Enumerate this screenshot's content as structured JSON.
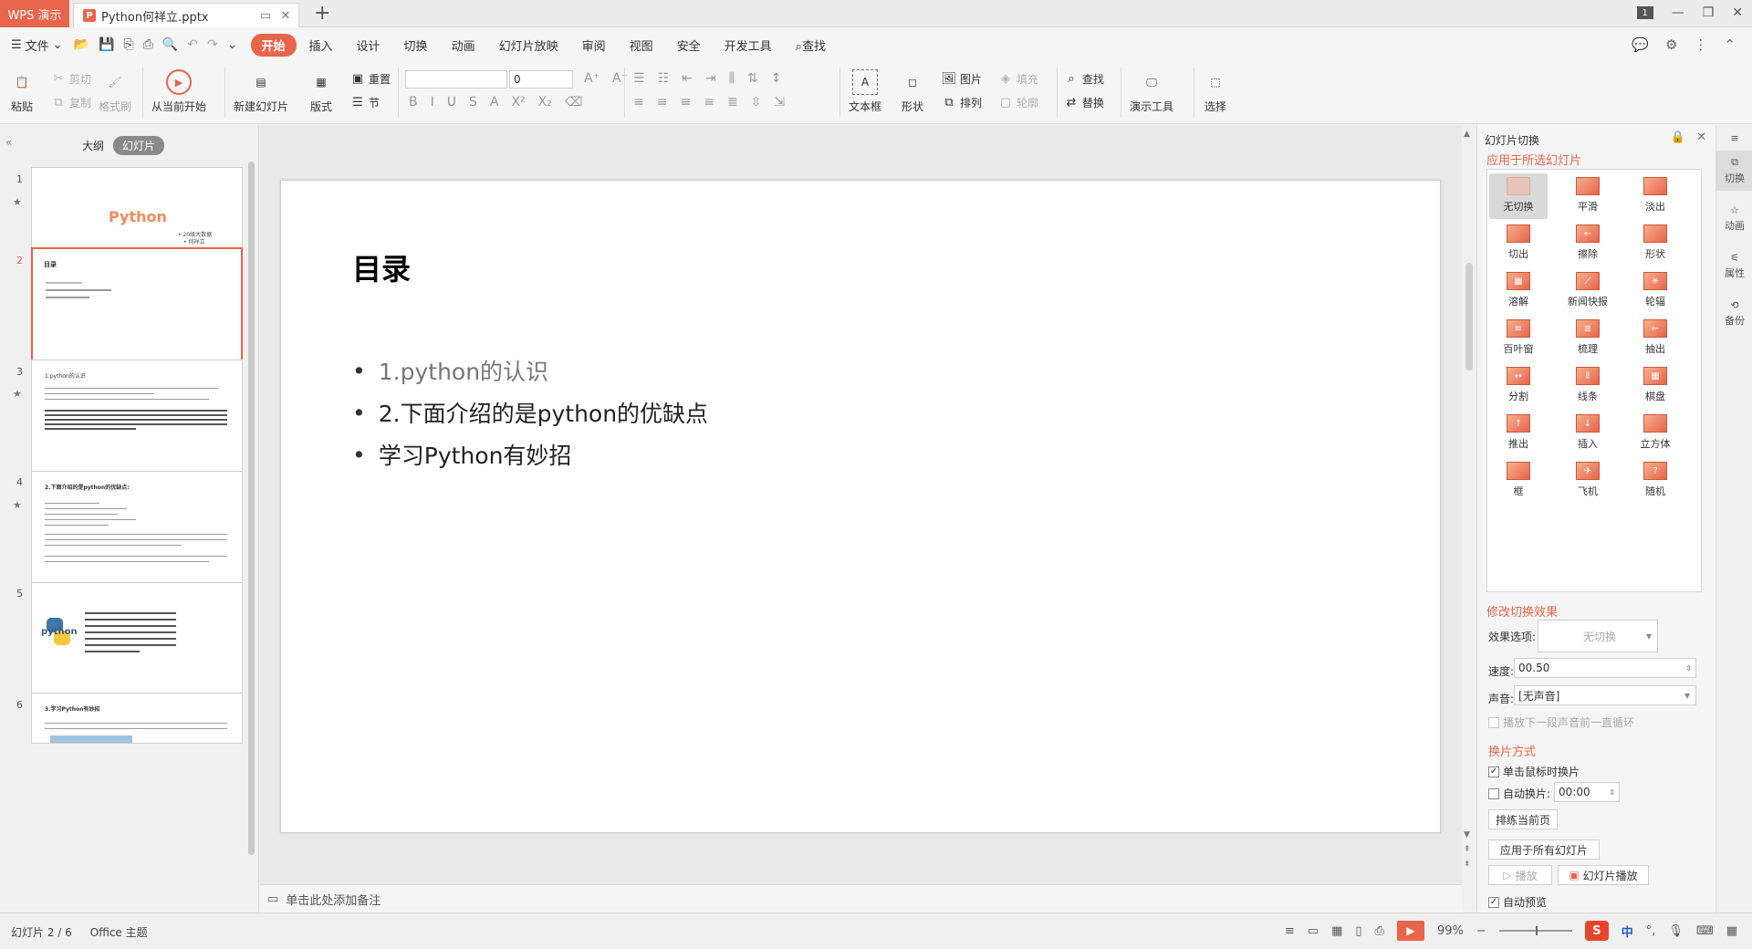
{
  "titlebar": {
    "app_tab": "WPS 演示",
    "doc_tab": "Python何祥立.pptx",
    "new_tab": "+",
    "badge": "1"
  },
  "menubar": {
    "file_label": "文件",
    "items": [
      "开始",
      "插入",
      "设计",
      "切换",
      "动画",
      "幻灯片放映",
      "审阅",
      "视图",
      "安全",
      "开发工具"
    ],
    "active_item": "开始",
    "search_label": "查找"
  },
  "ribbon": {
    "paste": "粘贴",
    "cut": "剪切",
    "copy": "复制",
    "format_painter": "格式刷",
    "from_current": "从当前开始",
    "new_slide": "新建幻灯片",
    "layout": "版式",
    "reset": "重置",
    "section": "节",
    "font_size": "0",
    "textbox": "文本框",
    "shape": "形状",
    "picture": "图片",
    "arrange": "排列",
    "fill": "填充",
    "outline": "轮廓",
    "find": "查找",
    "replace": "替换",
    "present_tools": "演示工具",
    "select": "选择"
  },
  "leftpane": {
    "tab_outline": "大纲",
    "tab_slides": "幻灯片",
    "thumbs": [
      {
        "num": "1",
        "title": "Python",
        "sub1": "• 20级大数据",
        "sub2": "• 何祥立"
      },
      {
        "num": "2",
        "title": "目录"
      },
      {
        "num": "3",
        "title": "1.python的认识"
      },
      {
        "num": "4",
        "title": "2.下面介绍的是python的优缺点:"
      },
      {
        "num": "5",
        "logo": "python"
      },
      {
        "num": "6",
        "title": "3.学习Python有妙招"
      }
    ]
  },
  "slide": {
    "title": "目录",
    "bullets": [
      "1.python的认识",
      "2.下面介绍的是python的优缺点",
      "学习Python有妙招"
    ]
  },
  "notes_placeholder": "单击此处添加备注",
  "rpane": {
    "title": "幻灯片切换",
    "apply_selected": "应用于所选幻灯片",
    "transitions": [
      "无切换",
      "平滑",
      "淡出",
      "切出",
      "擦除",
      "形状",
      "溶解",
      "新闻快报",
      "轮辐",
      "百叶窗",
      "梳理",
      "抽出",
      "分割",
      "线条",
      "棋盘",
      "推出",
      "插入",
      "立方体",
      "框",
      "飞机",
      "随机"
    ],
    "selected_transition": "无切换",
    "modify_title": "修改切换效果",
    "effect_label": "效果选项:",
    "effect_value": "无切换",
    "speed_label": "速度:",
    "speed_value": "00.50",
    "sound_label": "声音:",
    "sound_value": "[无声音]",
    "loop_label": "播放下一段声音前一直循环",
    "switch_title": "换片方式",
    "on_click_label": "单击鼠标时换片",
    "auto_label": "自动换片:",
    "auto_value": "00:00",
    "rehearse_btn": "排练当前页",
    "apply_all_btn": "应用于所有幻灯片",
    "play_btn": "播放",
    "slideshow_btn": "幻灯片播放",
    "autopreview_label": "自动预览"
  },
  "sidebar": {
    "items": [
      "切换",
      "动画",
      "属性",
      "备份"
    ]
  },
  "statusbar": {
    "slide_info": "幻灯片 2 / 6",
    "theme": "Office 主题",
    "zoom": "99%",
    "ime": "中"
  },
  "colors": {
    "accent": "#e8644b"
  }
}
